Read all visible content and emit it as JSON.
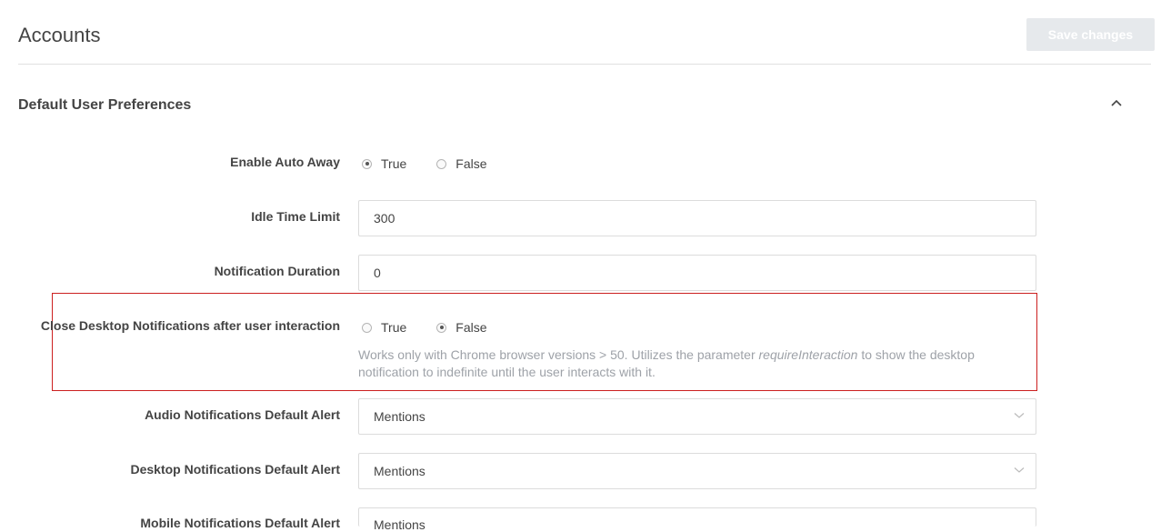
{
  "header": {
    "title": "Accounts",
    "save_label": "Save changes"
  },
  "section": {
    "title": "Default User Preferences",
    "collapse_icon": "chevron-up-icon"
  },
  "settings": {
    "enable_auto_away": {
      "label": "Enable Auto Away",
      "options": [
        "True",
        "False"
      ],
      "selected": "True"
    },
    "idle_time_limit": {
      "label": "Idle Time Limit",
      "value": "300"
    },
    "notification_duration": {
      "label": "Notification Duration",
      "value": "0"
    },
    "close_desktop_notifications": {
      "label": "Close Desktop Notifications after user interaction",
      "options": [
        "True",
        "False"
      ],
      "selected": "False",
      "hint_before": "Works only with Chrome browser versions > 50. Utilizes the parameter ",
      "hint_param": "requireInteraction",
      "hint_after": " to show the desktop notification to indefinite until the user interacts with it."
    },
    "audio_notifications": {
      "label": "Audio Notifications Default Alert",
      "value": "Mentions"
    },
    "desktop_notifications": {
      "label": "Desktop Notifications Default Alert",
      "value": "Mentions"
    },
    "mobile_notifications": {
      "label": "Mobile Notifications Default Alert",
      "value": "Mentions"
    }
  },
  "colors": {
    "highlight_border": "#cc1f1f",
    "save_button_bg": "#e6e9ec",
    "hint_text": "#9ea2a8"
  }
}
